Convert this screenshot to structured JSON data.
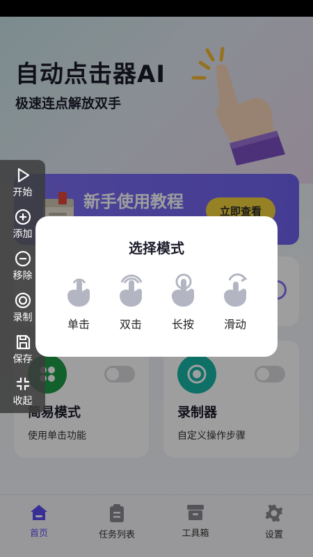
{
  "hero": {
    "title": "自动点击器AI",
    "subtitle": "极速连点解放双手"
  },
  "banner": {
    "text": "新手使用教程",
    "button": "立即查看"
  },
  "cards": [
    {
      "title": "简易模式",
      "desc": "使用单击功能",
      "icon": "apps-icon",
      "color": "#1e9c46"
    },
    {
      "title": "录制器",
      "desc": "自定义操作步骤",
      "icon": "record-icon",
      "color": "#17b5a5"
    }
  ],
  "float_bar": {
    "items": [
      {
        "label": "开始",
        "icon": "play-icon"
      },
      {
        "label": "添加",
        "icon": "plus-circle-icon"
      },
      {
        "label": "移除",
        "icon": "minus-circle-icon"
      },
      {
        "label": "录制",
        "icon": "record-icon"
      },
      {
        "label": "保存",
        "icon": "save-icon"
      },
      {
        "label": "收起",
        "icon": "collapse-icon"
      }
    ]
  },
  "modal": {
    "title": "选择模式",
    "modes": [
      {
        "label": "单击",
        "icon": "tap-icon"
      },
      {
        "label": "双击",
        "icon": "double-tap-icon"
      },
      {
        "label": "长按",
        "icon": "long-press-icon"
      },
      {
        "label": "滑动",
        "icon": "swipe-icon"
      }
    ]
  },
  "tabs": [
    {
      "label": "首页",
      "icon": "home-icon",
      "active": true
    },
    {
      "label": "任务列表",
      "icon": "clipboard-icon",
      "active": false
    },
    {
      "label": "工具箱",
      "icon": "toolbox-icon",
      "active": false
    },
    {
      "label": "设置",
      "icon": "gear-icon",
      "active": false
    }
  ],
  "colors": {
    "accent": "#5a4cf0",
    "banner": "#7d6ff5",
    "button_yellow": "#f2d23a"
  }
}
